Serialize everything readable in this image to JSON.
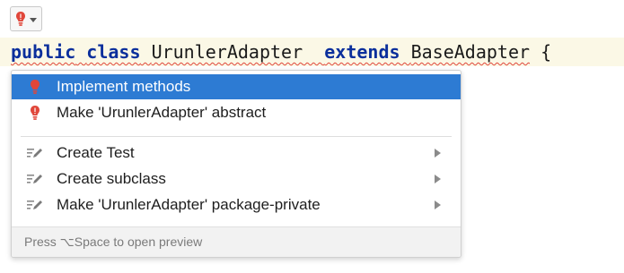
{
  "colors": {
    "keyword": "#0b2f9c",
    "error_underline": "#e0463a",
    "selection": "#2d7bd3",
    "bulb_red": "#e0463a",
    "line_highlight": "#fbf8e6"
  },
  "toolbar": {
    "bulb_icon": "red-bulb-icon",
    "dropdown_icon": "chevron-down-icon"
  },
  "code": {
    "kw_public": "public",
    "kw_class": "class",
    "class_name": "UrunlerAdapter",
    "kw_extends": "extends",
    "base_class": "BaseAdapter",
    "brace": "{"
  },
  "popup": {
    "items": [
      {
        "label": "Implement methods",
        "icon": "red-bulb-icon",
        "selected": true,
        "submenu": false
      },
      {
        "label": "Make 'UrunlerAdapter' abstract",
        "icon": "red-bulb-icon",
        "selected": false,
        "submenu": false
      },
      {
        "label": "Create Test",
        "icon": "intention-pencil-icon",
        "selected": false,
        "submenu": true
      },
      {
        "label": "Create subclass",
        "icon": "intention-pencil-icon",
        "selected": false,
        "submenu": true
      },
      {
        "label": "Make 'UrunlerAdapter' package-private",
        "icon": "intention-pencil-icon",
        "selected": false,
        "submenu": true
      }
    ],
    "footer": "Press ⌥Space to open preview"
  }
}
